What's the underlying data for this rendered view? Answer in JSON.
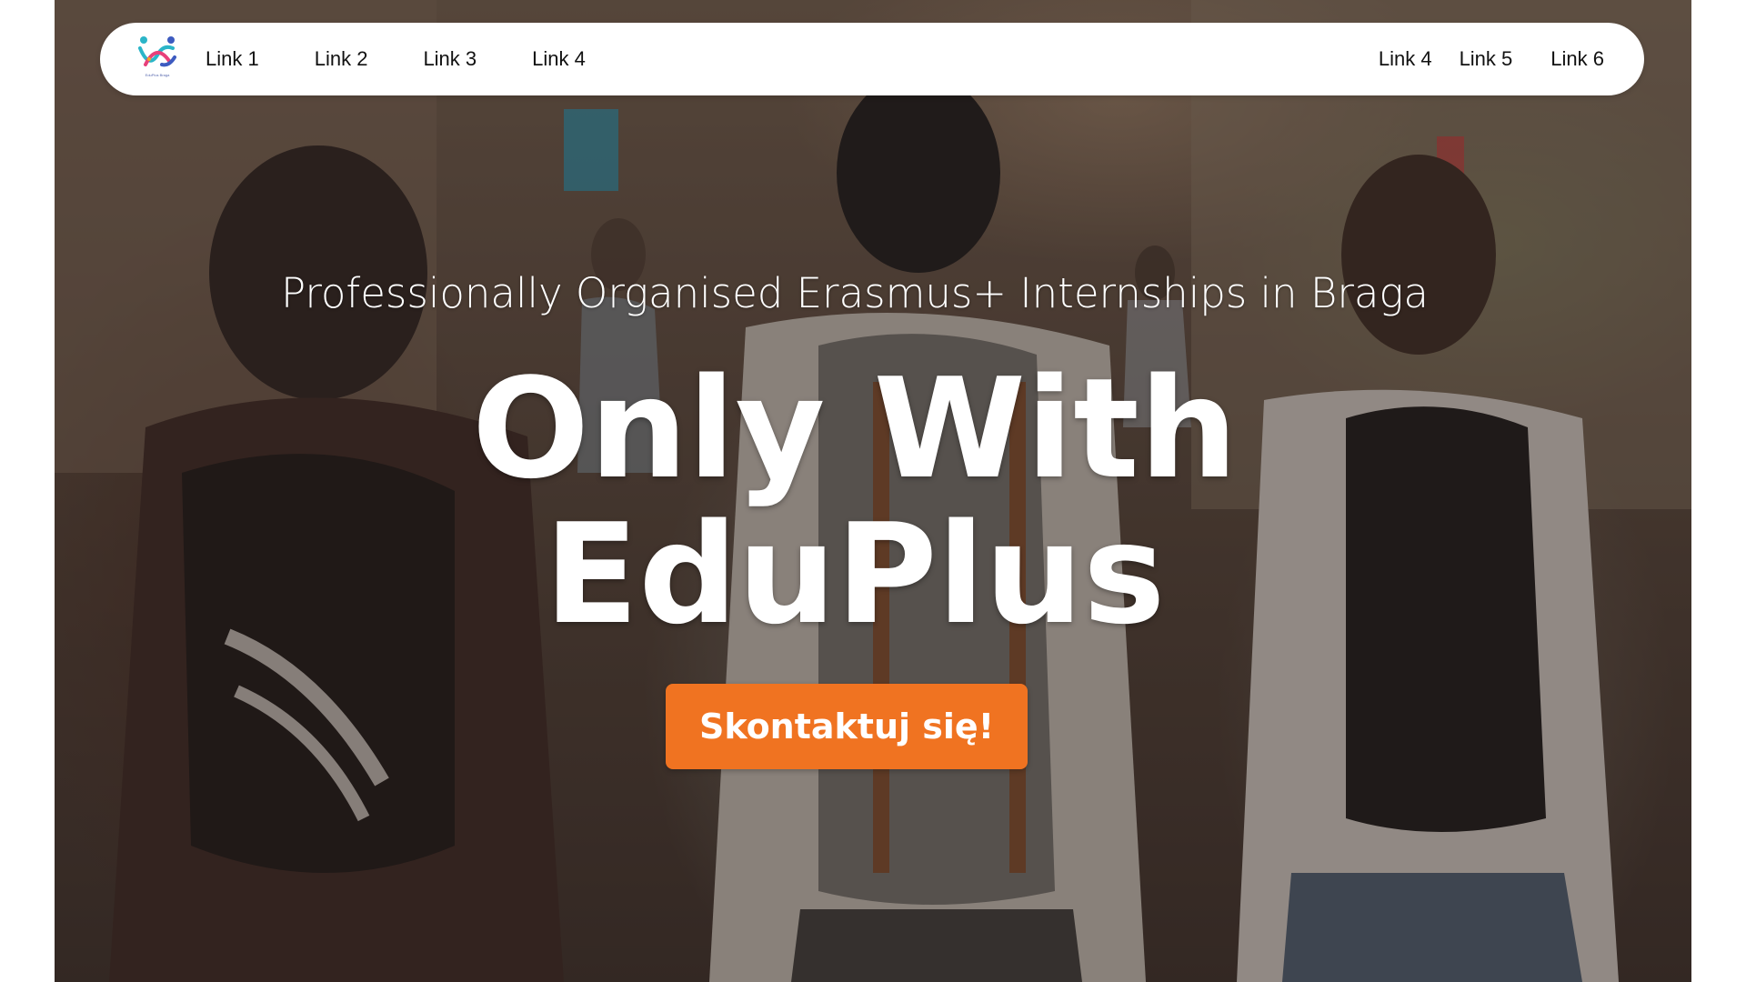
{
  "nav": {
    "logo_caption": "EduPlus Braga",
    "left_links": [
      "Link 1",
      "Link 2",
      "Link 3",
      "Link 4"
    ],
    "right_links": [
      "Link 4",
      "Link 5",
      "Link 6"
    ]
  },
  "hero": {
    "subtitle": "Professionally Organised Erasmus+ Internships in Braga",
    "headline_line1": "Only With",
    "headline_line2": "EduPlus",
    "cta_label": "Skontaktuj się!"
  },
  "colors": {
    "cta": "#f07321",
    "navbar_bg": "#ffffff",
    "text_light": "#ffffff",
    "logo_teal": "#2bb5c8",
    "logo_blue": "#3d5bc0",
    "logo_pink": "#e8407a",
    "logo_orange": "#f5a623"
  }
}
